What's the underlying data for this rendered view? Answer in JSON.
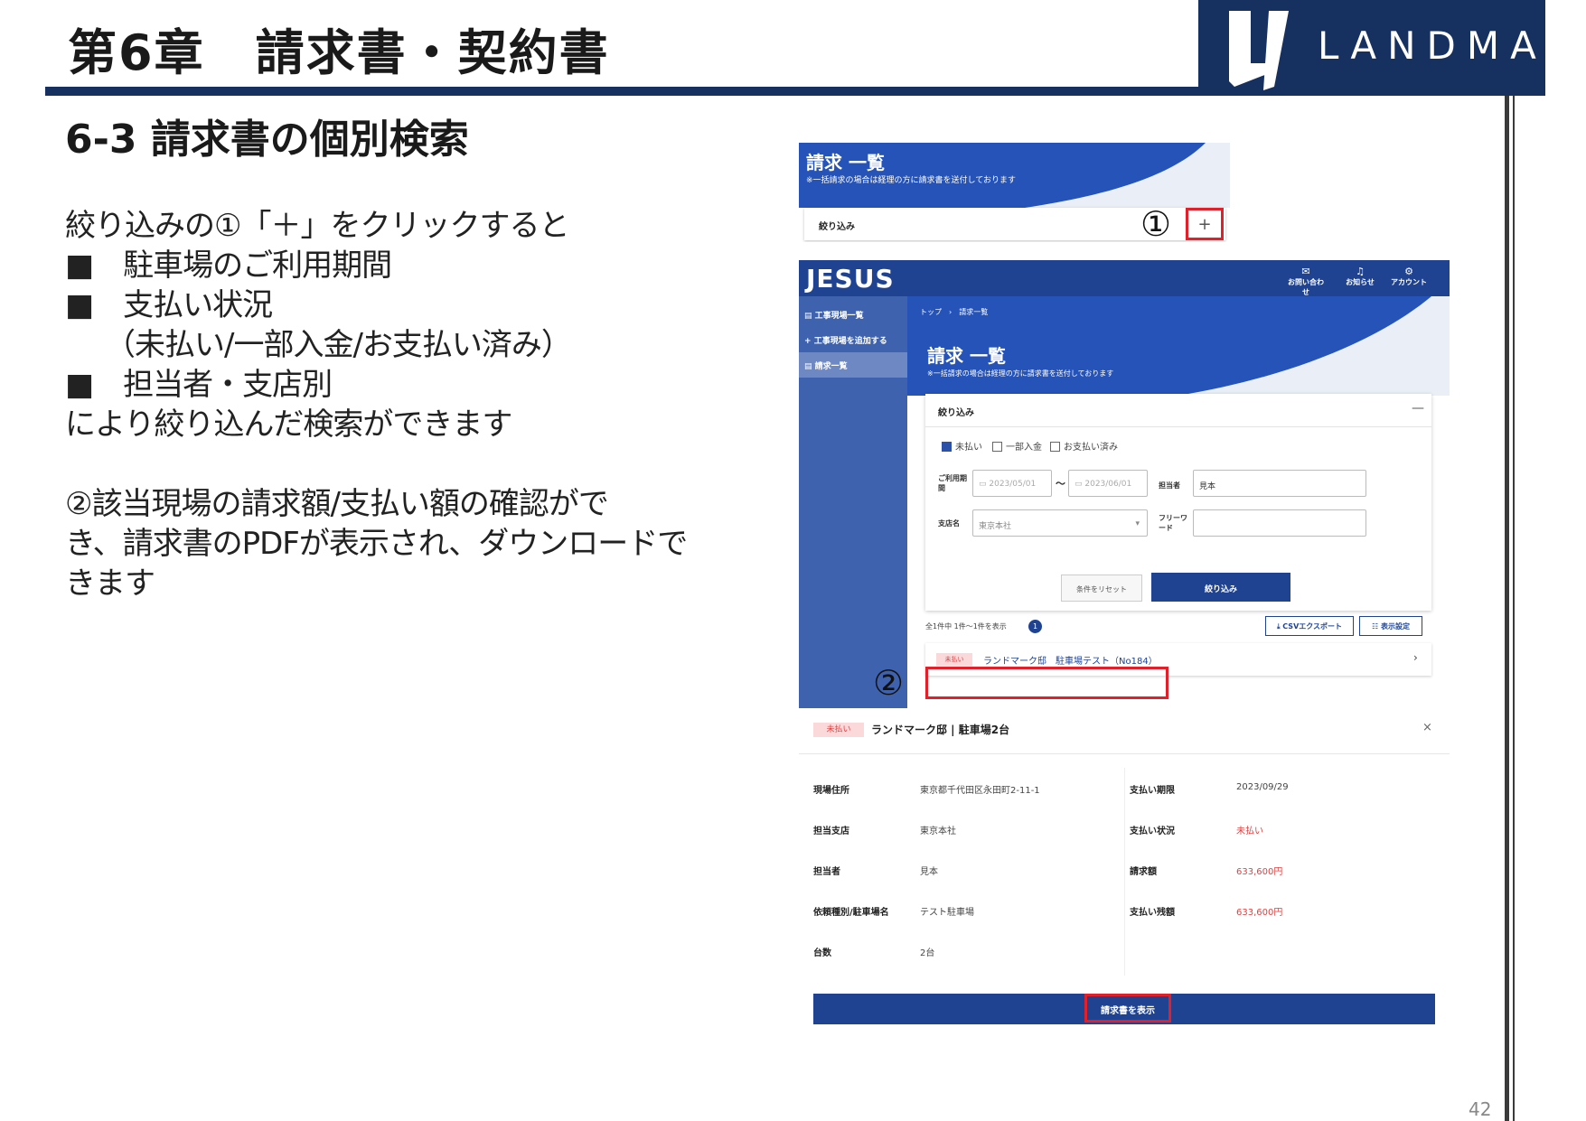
{
  "slide": {
    "chapter_title": "第6章　請求書・契約書",
    "section_title": "6-3  請求書の個別検索",
    "logo_text": "LANDMARK",
    "page_number": "42",
    "brand_color": "#16305f",
    "highlight_color": "#e0202a"
  },
  "description": {
    "lines": [
      "絞り込みの①「＋」をクリックすると",
      "■　駐車場のご利用期間",
      "■　支払い状況",
      "　（未払い/一部入金/お支払い済み）",
      "■　担当者・支店別",
      "により絞り込んだ検索ができます",
      "②該当現場の請求額/支払い額の確認がで",
      "き、請求書のPDFが表示され、ダウンロードで",
      "きます"
    ]
  },
  "callouts": {
    "one": "①",
    "two": "②"
  },
  "screenshot_a": {
    "title": "請求 一覧",
    "note": "※一括請求の場合は経理の方に請求書を送付しております",
    "filter_label": "絞り込み",
    "plus_label": "+"
  },
  "screenshot_b": {
    "brand": "JESUS",
    "nav": [
      {
        "icon": "✉",
        "label": "お問い合わせ"
      },
      {
        "icon": "♫",
        "label": "お知らせ"
      },
      {
        "icon": "⚙",
        "label": "アカウント"
      }
    ],
    "sidebar": [
      {
        "icon": "▤",
        "label": "工事現場一覧"
      },
      {
        "icon": "+",
        "label": "工事現場を追加する"
      },
      {
        "icon": "▤",
        "label": "請求一覧"
      }
    ],
    "breadcrumb": "トップ　›　請求一覧",
    "title": "請求 一覧",
    "note": "※一括請求の場合は経理の方に請求書を送付しております",
    "filter": {
      "label": "絞り込み",
      "collapse": "—",
      "status_options": [
        "未払い",
        "一部入金",
        "お支払い済み"
      ],
      "period_label": "ご利用期間",
      "date_from": "2023/05/01",
      "date_to": "2023/06/01",
      "date_sep": "〜",
      "person_label": "担当者",
      "person_value": "見本",
      "branch_label": "支店名",
      "branch_value": "東京本社",
      "freeword_label": "フリーワード",
      "freeword_value": "",
      "reset_button": "条件をリセット",
      "apply_button": "絞り込み"
    },
    "result_count": "全1件中 1件〜1件を表示",
    "result_badge": "1",
    "csv_button": "⤓ CSVエクスポート",
    "display_button": "☷ 表示設定",
    "result_row": {
      "status": "未払い",
      "text": "ランドマーク邸　駐車場テスト（No184）",
      "chevron": "›"
    }
  },
  "screenshot_c": {
    "status": "未払い",
    "title": "ランドマーク邸 | 駐車場2台",
    "close": "×",
    "left": [
      {
        "key": "現場住所",
        "value": "東京都千代田区永田町2-11-1"
      },
      {
        "key": "担当支店",
        "value": "東京本社"
      },
      {
        "key": "担当者",
        "value": "見本"
      },
      {
        "key": "依頼種別/駐車場名",
        "value": "テスト駐車場"
      },
      {
        "key": "台数",
        "value": "2台"
      }
    ],
    "right": [
      {
        "key": "支払い期限",
        "value": "2023/09/29"
      },
      {
        "key": "支払い状況",
        "value": "未払い"
      },
      {
        "key": "請求額",
        "value": "633,600円"
      },
      {
        "key": "支払い残額",
        "value": "633,600円"
      }
    ],
    "invoice_button": "請求書を表示"
  }
}
